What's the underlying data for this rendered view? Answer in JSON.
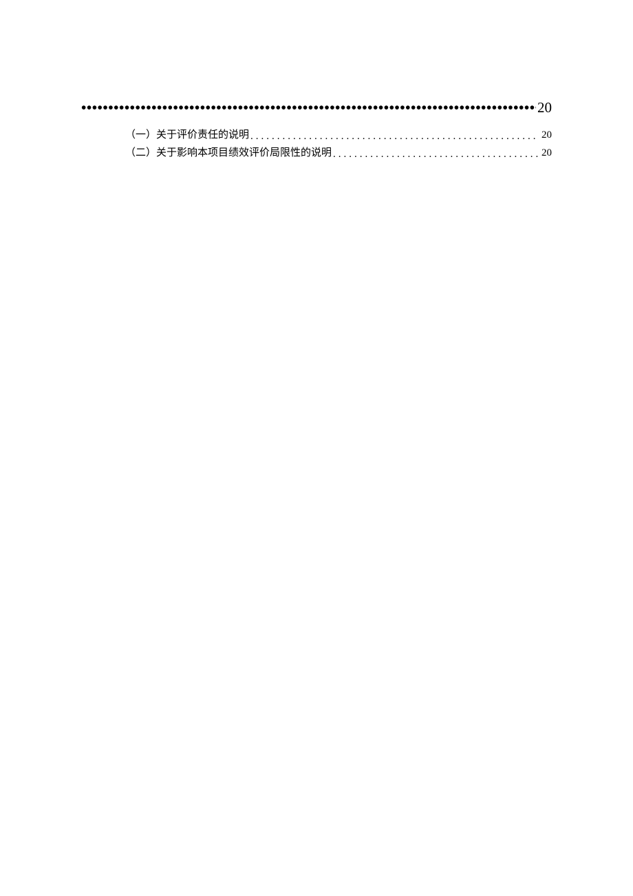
{
  "section": {
    "leader": "••••••••••••••••••••••••••••••••••••••••••••••••••••••••••••••••••••••••••••••••••••••••••••••••••••••••••••••••••••••••",
    "page": "20"
  },
  "toc": [
    {
      "label": "（一）关于评价责任的说明",
      "dots": "................................................................................................................",
      "page": "20"
    },
    {
      "label": "（二）关于影响本项目绩效评价局限性的说明",
      "dots": "................................................................................................................",
      "page": "20"
    }
  ]
}
